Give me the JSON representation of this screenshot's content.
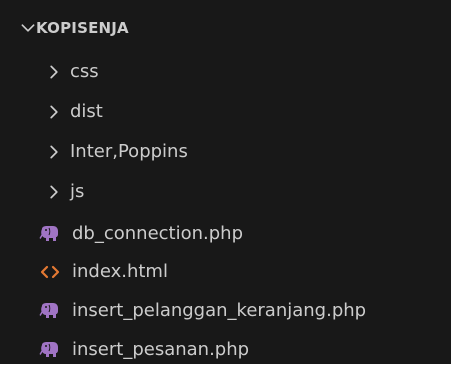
{
  "explorer": {
    "root": {
      "label": "KOPISENJA",
      "icon": "chevron-down-icon"
    },
    "folders": [
      {
        "label": "css",
        "icon": "chevron-right-icon"
      },
      {
        "label": "dist",
        "icon": "chevron-right-icon"
      },
      {
        "label": "Inter,Poppins",
        "icon": "chevron-right-icon"
      },
      {
        "label": "js",
        "icon": "chevron-right-icon"
      }
    ],
    "files": [
      {
        "label": "db_connection.php",
        "icon": "php-elephant-icon"
      },
      {
        "label": "index.html",
        "icon": "html-brackets-icon"
      },
      {
        "label": "insert_pelanggan_keranjang.php",
        "icon": "php-elephant-icon"
      },
      {
        "label": "insert_pesanan.php",
        "icon": "php-elephant-icon"
      }
    ]
  },
  "colors": {
    "background": "#181818",
    "text": "#cccccc",
    "php_icon": "#a074c4",
    "html_icon": "#e37933"
  }
}
